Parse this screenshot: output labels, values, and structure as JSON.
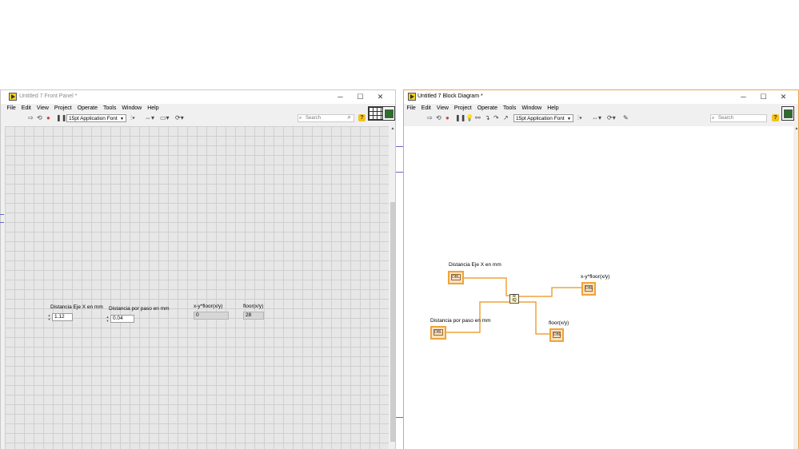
{
  "front_panel": {
    "title": "Untitled 7 Front Panel *",
    "menu": [
      "File",
      "Edit",
      "View",
      "Project",
      "Operate",
      "Tools",
      "Window",
      "Help"
    ],
    "font": "15pt Application Font",
    "search_placeholder": "Search",
    "controls": [
      {
        "label": "Distancia Eje X en mm",
        "value": "1.12"
      },
      {
        "label": "Distancia por paso en mm",
        "value": "0.04"
      }
    ],
    "indicators": [
      {
        "label": "x-y*floor(x/y)",
        "value": "0"
      },
      {
        "label": "floor(x/y)",
        "value": "28"
      }
    ]
  },
  "block_diagram": {
    "title": "Untitled 7 Block Diagram *",
    "menu": [
      "File",
      "Edit",
      "View",
      "Project",
      "Operate",
      "Tools",
      "Window",
      "Help"
    ],
    "font": "15pt Application Font",
    "search_placeholder": "Search",
    "terminals": {
      "control_x": "Distancia Eje X en mm",
      "control_y": "Distancia por paso en mm",
      "indicator_remainder": "x-y*floor(x/y)",
      "indicator_quotient": "floor(x/y)"
    },
    "terminal_text": "DBL",
    "function_node": "Quotient & Remainder"
  },
  "window_controls": {
    "minimize": "─",
    "maximize": "☐",
    "close": "✕"
  },
  "colors": {
    "wire": "#f0a33a",
    "grid": "#cfcfcf",
    "accent_border": "#e8a552"
  }
}
